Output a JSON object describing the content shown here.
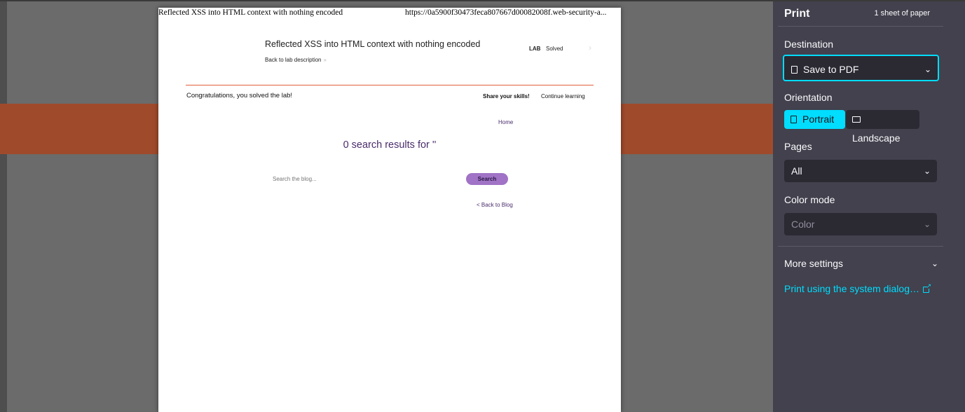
{
  "preview": {
    "header_title": "Reflected XSS into HTML context with nothing encoded",
    "header_url": "https://0a5900f30473feca807667d00082008f.web-security-a...",
    "lab_title": "Reflected XSS into HTML context with nothing encoded",
    "back_to_description": "Back to lab description",
    "back_chevron": "»",
    "lab_badge": "LAB",
    "lab_status": "Solved",
    "congrats": "Congratulations, you solved the lab!",
    "share": "Share your skills!",
    "continue": "Continue learning",
    "nav_home": "Home",
    "results": "0 search results for ''",
    "search_placeholder": "Search the blog...",
    "search_button": "Search",
    "back_to_blog": "< Back to Blog",
    "accent_rule_color": "#e0603a"
  },
  "print_panel": {
    "title": "Print",
    "sheets": "1 sheet of paper",
    "destination_label": "Destination",
    "destination_value": "Save to PDF",
    "orientation_label": "Orientation",
    "portrait": "Portrait",
    "landscape": "Landscape",
    "pages_label": "Pages",
    "pages_value": "All",
    "color_mode_label": "Color mode",
    "color_mode_value": "Color",
    "more_settings": "More settings",
    "system_dialog": "Print using the system dialog…",
    "accent_color": "#00ddff"
  }
}
